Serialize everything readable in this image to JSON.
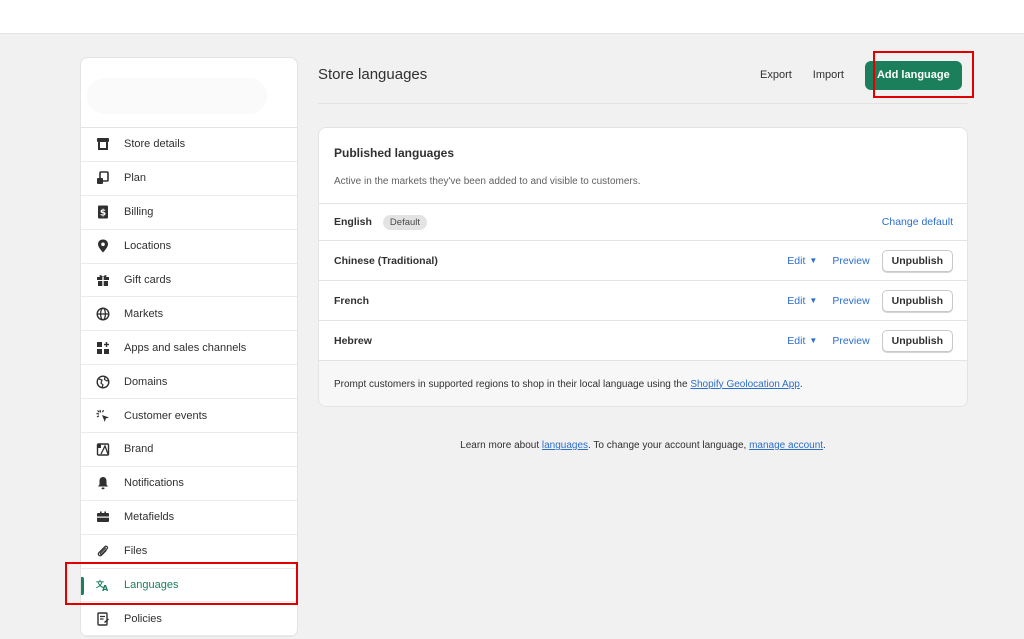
{
  "sidebar": {
    "items": [
      {
        "label": "Store details",
        "icon": "store-icon"
      },
      {
        "label": "Plan",
        "icon": "plan-icon"
      },
      {
        "label": "Billing",
        "icon": "billing-icon"
      },
      {
        "label": "Locations",
        "icon": "location-pin-icon"
      },
      {
        "label": "Gift cards",
        "icon": "gift-icon"
      },
      {
        "label": "Markets",
        "icon": "globe-icon"
      },
      {
        "label": "Apps and sales channels",
        "icon": "apps-icon"
      },
      {
        "label": "Domains",
        "icon": "domain-globe-icon"
      },
      {
        "label": "Customer events",
        "icon": "cursor-click-icon"
      },
      {
        "label": "Brand",
        "icon": "brand-icon"
      },
      {
        "label": "Notifications",
        "icon": "bell-icon"
      },
      {
        "label": "Metafields",
        "icon": "metafields-icon"
      },
      {
        "label": "Files",
        "icon": "paperclip-icon"
      },
      {
        "label": "Languages",
        "icon": "translate-icon",
        "active": true
      },
      {
        "label": "Policies",
        "icon": "policy-icon"
      }
    ]
  },
  "header": {
    "title": "Store languages",
    "export_label": "Export",
    "import_label": "Import",
    "add_language_label": "Add language"
  },
  "published": {
    "title": "Published languages",
    "description": "Active in the markets they've been added to and visible to customers.",
    "default_language": "English",
    "default_badge": "Default",
    "change_default_label": "Change default",
    "languages": [
      {
        "name": "Chinese (Traditional)",
        "edit_label": "Edit",
        "preview_label": "Preview",
        "unpublish_label": "Unpublish"
      },
      {
        "name": "French",
        "edit_label": "Edit",
        "preview_label": "Preview",
        "unpublish_label": "Unpublish"
      },
      {
        "name": "Hebrew",
        "edit_label": "Edit",
        "preview_label": "Preview",
        "unpublish_label": "Unpublish"
      }
    ],
    "footer_prefix": "Prompt customers in supported regions to shop in their local language using the ",
    "footer_link": "Shopify Geolocation App",
    "footer_suffix": "."
  },
  "learn_more": {
    "prefix": "Learn more about ",
    "link1": "languages",
    "middle": ". To change your account language, ",
    "link2": "manage account",
    "suffix": "."
  },
  "colors": {
    "accent": "#1a7f5a",
    "link": "#2c6ecb",
    "highlight": "#e00000"
  }
}
